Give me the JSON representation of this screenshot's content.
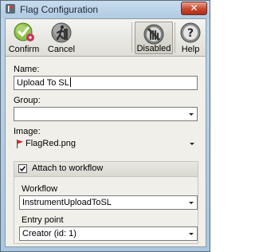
{
  "window": {
    "title": "Flag Configuration",
    "close_glyph": "✕"
  },
  "toolbar": {
    "confirm": {
      "label": "Confirm",
      "icon": "confirm-icon"
    },
    "cancel": {
      "label": "Cancel",
      "icon": "cancel-icon"
    },
    "disabled": {
      "label": "Disabled",
      "icon": "disabled-icon",
      "pressed": true
    },
    "help": {
      "label": "Help",
      "icon": "help-icon"
    }
  },
  "form": {
    "name": {
      "label": "Name:",
      "value": "Upload To SL"
    },
    "group": {
      "label": "Group:",
      "value": ""
    },
    "image": {
      "label": "Image:",
      "value": "FlagRed.png",
      "icon": "red-flag-icon"
    },
    "attach": {
      "label": "Attach to workflow",
      "checked": true
    },
    "workflow": {
      "label": "Workflow",
      "value": "InstrumentUploadToSL"
    },
    "entry_point": {
      "label": "Entry point",
      "value": "Creator (id: 1)"
    }
  },
  "colors": {
    "title_bar": "#b8d2e8",
    "close_button": "#c7462e",
    "flag_red": "#d81e1e"
  }
}
